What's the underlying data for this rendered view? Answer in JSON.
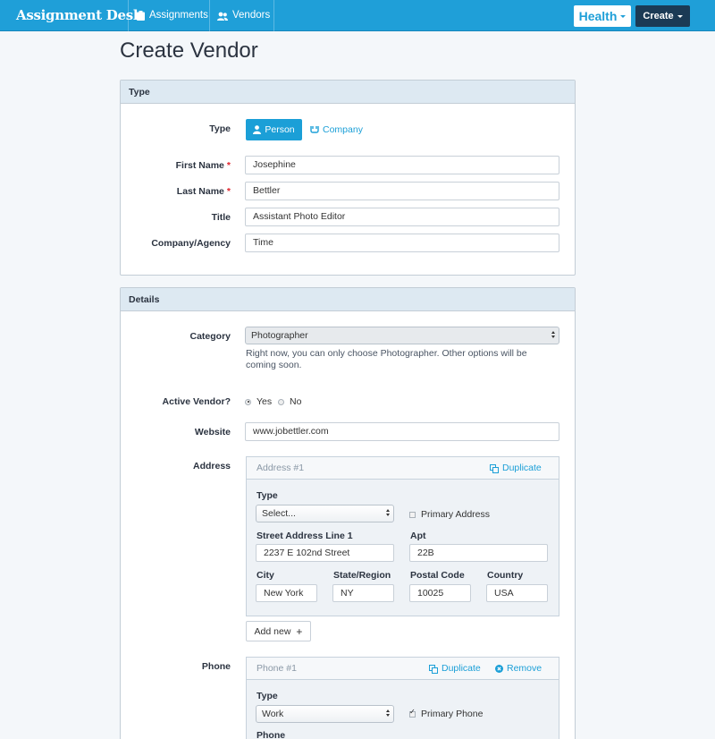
{
  "nav": {
    "brand": "Assignment Desk",
    "links": [
      "Assignments",
      "Vendors"
    ],
    "health_label": "Health",
    "create_label": "Create"
  },
  "page": {
    "title": "Create Vendor"
  },
  "type_panel": {
    "title": "Type",
    "type_label": "Type",
    "options": [
      "Person",
      "Company"
    ],
    "selected": "Person",
    "fields": [
      {
        "label": "First Name",
        "required": true,
        "value": "Josephine"
      },
      {
        "label": "Last Name",
        "required": true,
        "value": "Bettler"
      },
      {
        "label": "Title",
        "required": false,
        "value": "Assistant Photo Editor"
      },
      {
        "label": "Company/Agency",
        "required": false,
        "value": "Time"
      }
    ]
  },
  "details_panel": {
    "title": "Details",
    "category_label": "Category",
    "category_value": "Photographer",
    "category_help": "Right now, you can only choose Photographer. Other options will be coming soon.",
    "active_label": "Active Vendor?",
    "active_yes": "Yes",
    "active_no": "No",
    "active_selected": "Yes",
    "website_label": "Website",
    "website_value": "www.jobettler.com",
    "address_label": "Address",
    "address": {
      "header": "Address #1",
      "duplicate": "Duplicate",
      "type_label": "Type",
      "type_value": "Select...",
      "primary_label": "Primary Address",
      "primary_checked": false,
      "street_label": "Street Address Line 1",
      "street_value": "2237 E 102nd Street",
      "apt_label": "Apt",
      "apt_value": "22B",
      "city_label": "City",
      "city_value": "New York",
      "state_label": "State/Region",
      "state_value": "NY",
      "postal_label": "Postal Code",
      "postal_value": "10025",
      "country_label": "Country",
      "country_value": "USA"
    },
    "add_new_label": "Add new",
    "phone_label": "Phone",
    "phone": {
      "header": "Phone #1",
      "duplicate": "Duplicate",
      "remove": "Remove",
      "type_label": "Type",
      "type_value": "Work",
      "primary_label": "Primary Phone",
      "primary_checked": true,
      "phone_sub_label": "Phone"
    }
  },
  "colors": {
    "accent": "#1f9fd8",
    "navbar": "#1f9fd8",
    "create_btn": "#1b3a55",
    "required": "#e0242d",
    "panel_head": "#dde9f2"
  }
}
